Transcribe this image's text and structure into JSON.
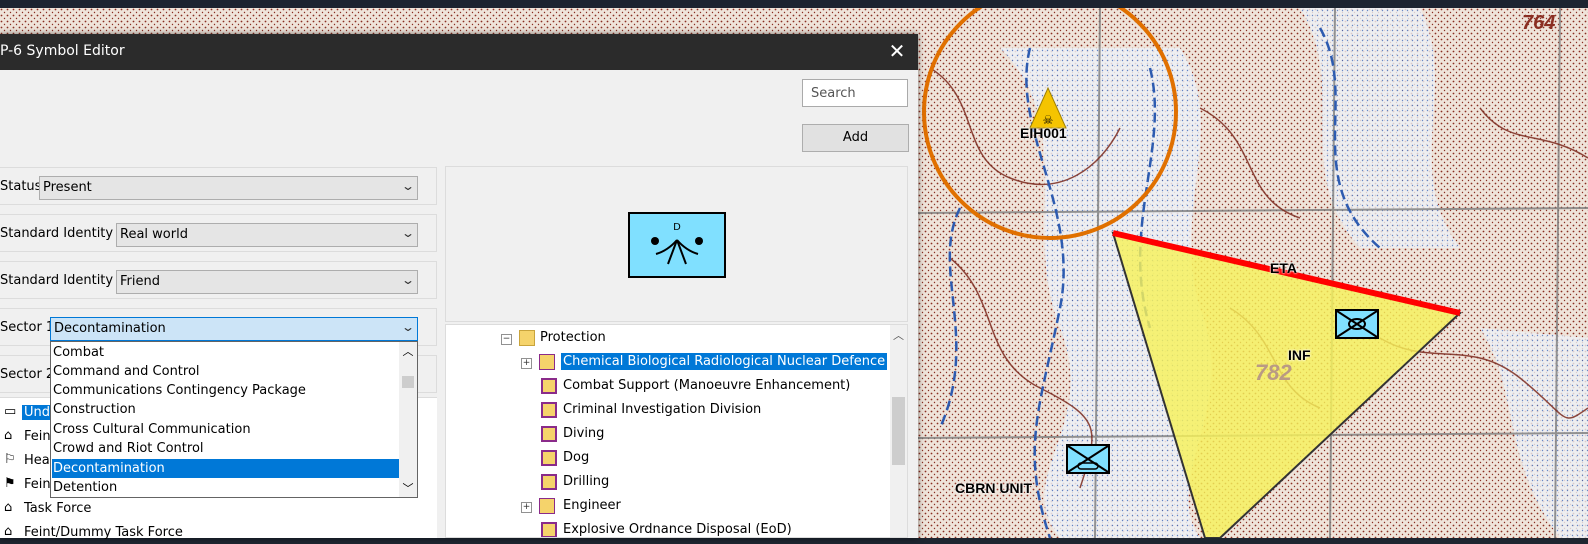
{
  "dialog": {
    "title": "P-6 Symbol Editor",
    "close_glyph": "✕",
    "search_placeholder": "Search",
    "add_label": "Add"
  },
  "fields": {
    "status": {
      "label": "Status",
      "value": "Present"
    },
    "standard_identity_1": {
      "label": "Standard Identity 1",
      "value": "Real world"
    },
    "standard_identity_2": {
      "label": "Standard Identity 2",
      "value": "Friend"
    },
    "sector_1": {
      "label": "Sector 1",
      "value": "Decontamination"
    },
    "sector_2": {
      "label": "Sector 2"
    }
  },
  "preview": {
    "modifier_letter": "D",
    "fill_color": "#80e0ff"
  },
  "sector_dropdown": {
    "options": [
      "Combat",
      "Command and Control",
      "Communications Contingency Package",
      "Construction",
      "Cross Cultural Communication",
      "Crowd and Riot Control",
      "Decontamination",
      "Detention"
    ],
    "selected": "Decontamination"
  },
  "left_list": {
    "items": [
      {
        "text": "Unde",
        "icon": "rect-icon"
      },
      {
        "text": "Fein",
        "icon": "feint-icon"
      },
      {
        "text": "Head",
        "icon": "flag-icon"
      },
      {
        "text": "Fein",
        "icon": "feint-flag-icon"
      },
      {
        "text": "Task Force",
        "icon": "task-force-icon"
      },
      {
        "text": "Feint/Dummy Task Force",
        "icon": "feint-task-force-icon"
      }
    ]
  },
  "tree": {
    "items": [
      {
        "label": "Protection",
        "kind": "folder",
        "expander": "−"
      },
      {
        "label": "Chemical Biological Radiological Nuclear Defence",
        "kind": "symbol-folder",
        "expander": "+",
        "selected": true
      },
      {
        "label": "Combat Support (Manoeuvre Enhancement)",
        "kind": "symbol"
      },
      {
        "label": "Criminal Investigation Division",
        "kind": "symbol"
      },
      {
        "label": "Diving",
        "kind": "symbol"
      },
      {
        "label": "Dog",
        "kind": "symbol"
      },
      {
        "label": "Drilling",
        "kind": "symbol"
      },
      {
        "label": "Engineer",
        "kind": "symbol-folder",
        "expander": "+"
      },
      {
        "label": "Explosive Ordnance Disposal (EoD)",
        "kind": "symbol"
      }
    ]
  },
  "map": {
    "labels": {
      "hazard": "EIH001",
      "line": "ETA",
      "area": "INF",
      "cbrn": "CBRN UNIT",
      "contour_a": "782",
      "contour_b": "764"
    },
    "colors": {
      "area_fill": "#f7f25a",
      "area_edge": "#ff0000",
      "circle": "#e07000",
      "hazard": "#f5c400",
      "contour": "#7b2a1e",
      "water": "#2d5bb0"
    }
  }
}
